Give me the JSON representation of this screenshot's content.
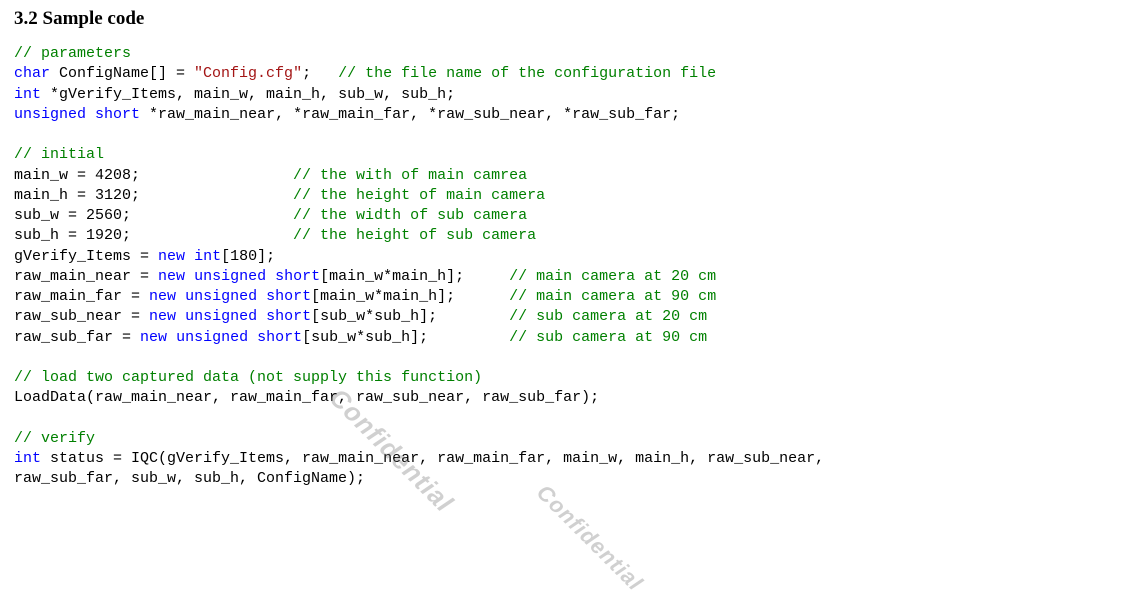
{
  "heading": "3.2 Sample code",
  "watermark": "Confidential",
  "code": {
    "parameters_comment": "// parameters",
    "char_kw": "char",
    "config_decl_before": " ConfigName[] = ",
    "config_string": "\"Config.cfg\"",
    "config_decl_after": ";   ",
    "config_comment": "// the file name of the configuration file",
    "int_kw": "int",
    "gverify_decl": " *gVerify_Items, main_w, main_h, sub_w, sub_h;",
    "unsigned_kw": "unsigned",
    "space1": " ",
    "short_kw": "short",
    "raw_decl": " *raw_main_near, *raw_main_far, *raw_sub_near, *raw_sub_far;",
    "initial_comment": "// initial",
    "main_w_assign": "main_w = 4208;                 ",
    "main_w_comment": "// the with of main camrea",
    "main_h_assign": "main_h = 3120;                 ",
    "main_h_comment": "// the height of main camera",
    "sub_w_assign": "sub_w = 2560;                  ",
    "sub_w_comment": "// the width of sub camera",
    "sub_h_assign": "sub_h = 1920;                  ",
    "sub_h_comment": "// the height of sub camera",
    "gverify_assign_before": "gVerify_Items = ",
    "new_kw": "new",
    "gverify_assign_after": " ",
    "int_kw2": "int",
    "gverify_bracket": "[180];",
    "rmn_before": "raw_main_near = ",
    "rmn_mid": "[main_w*main_h];     ",
    "rmn_comment": "// main camera at 20 cm",
    "rmf_before": "raw_main_far = ",
    "rmf_mid": "[main_w*main_h];      ",
    "rmf_comment": "// main camera at 90 cm",
    "rsn_before": "raw_sub_near = ",
    "rsn_mid": "[sub_w*sub_h];        ",
    "rsn_comment": "// sub camera at 20 cm",
    "rsf_before": "raw_sub_far = ",
    "rsf_mid": "[sub_w*sub_h];         ",
    "rsf_comment": "// sub camera at 90 cm",
    "load_comment": "// load two captured data (not supply this function)",
    "load_call": "LoadData(raw_main_near, raw_main_far, raw_sub_near, raw_sub_far);",
    "verify_comment": "// verify",
    "status_decl": " status = IQC(gVerify_Items, raw_main_near, raw_main_far, main_w, main_h, raw_sub_near,",
    "status_line2": "raw_sub_far, sub_w, sub_h, ConfigName);"
  }
}
